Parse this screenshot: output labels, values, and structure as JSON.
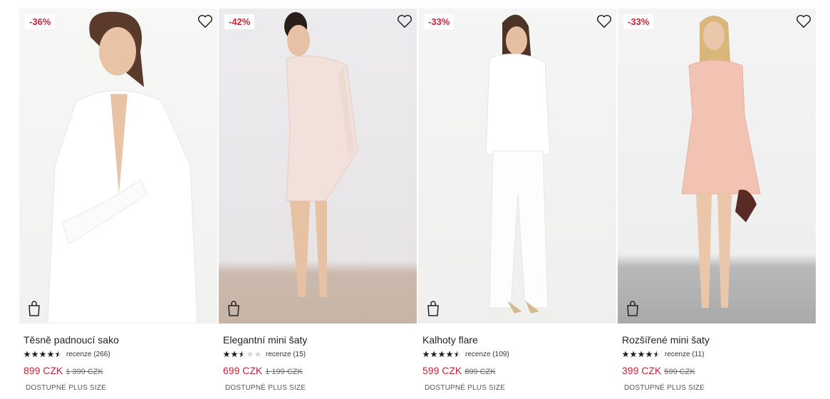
{
  "products": [
    {
      "discount": "-36%",
      "name": "Těsně padnoucí sako",
      "rating": 4.5,
      "reviews": "recenze (266)",
      "price": "899 CZK",
      "old_price": "1 399 CZK",
      "tag": "DOSTUPNÉ PLUS SIZE"
    },
    {
      "discount": "-42%",
      "name": "Elegantní mini šaty",
      "rating": 2.5,
      "reviews": "recenze (15)",
      "price": "699 CZK",
      "old_price": "1 199 CZK",
      "tag": "DOSTUPNÉ PLUS SIZE"
    },
    {
      "discount": "-33%",
      "name": "Kalhoty flare",
      "rating": 4.5,
      "reviews": "recenze (109)",
      "price": "599 CZK",
      "old_price": "899 CZK",
      "tag": "DOSTUPNÉ PLUS SIZE"
    },
    {
      "discount": "-33%",
      "name": "Rozšířené mini šaty",
      "rating": 4.5,
      "reviews": "recenze (11)",
      "price": "399 CZK",
      "old_price": "599 CZK",
      "tag": "DOSTUPNÉ PLUS SIZE"
    }
  ],
  "icons": {
    "wishlist": "heart-icon",
    "cart": "shopping-bag-icon",
    "rating": "star-icon"
  },
  "colors": {
    "accent": "#c4253b",
    "star": "#222222",
    "star_empty": "#d6d6d6"
  }
}
